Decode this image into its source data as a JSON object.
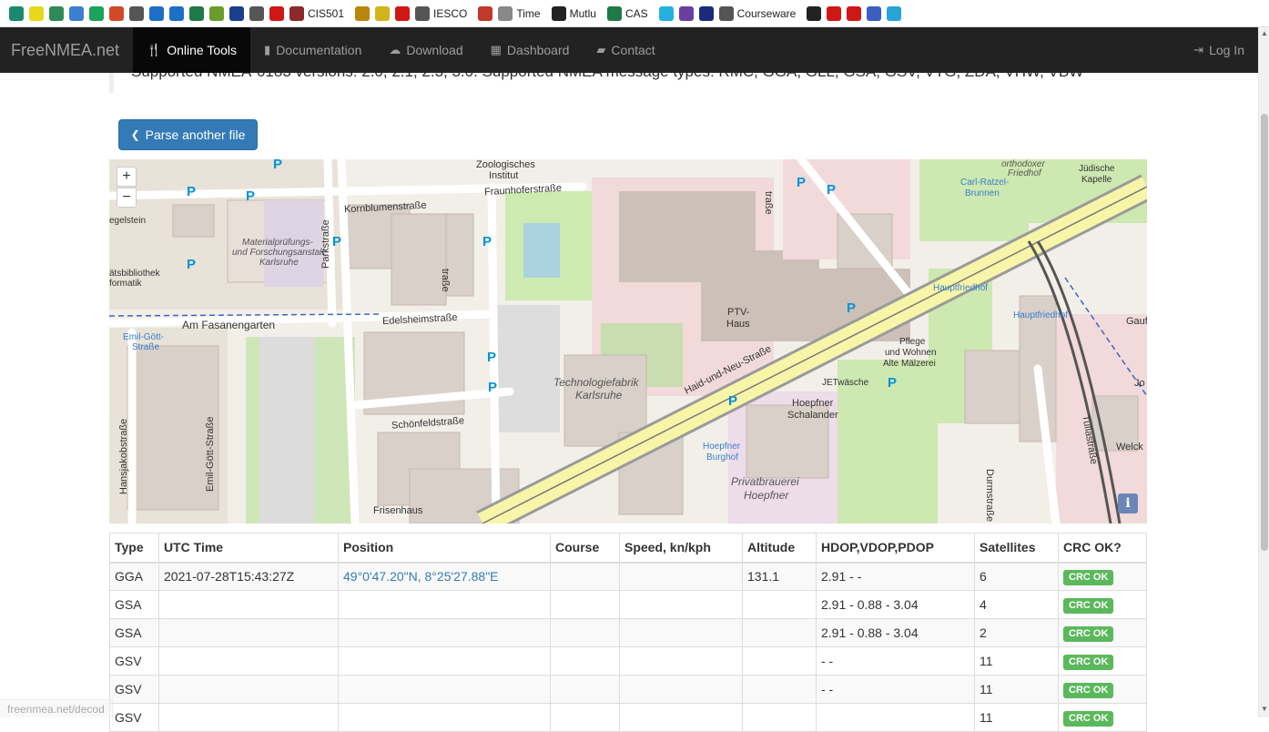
{
  "bookmarks": [
    {
      "icon": "diamond-icon",
      "color": "#1a8a6e",
      "label": ""
    },
    {
      "icon": "c-icon",
      "color": "#e8d81a",
      "label": ""
    },
    {
      "icon": "leaf-icon",
      "color": "#2e8b57",
      "label": ""
    },
    {
      "icon": "photo-icon",
      "color": "#3b7fd1",
      "label": ""
    },
    {
      "icon": "target-icon",
      "color": "#1aa35a",
      "label": ""
    },
    {
      "icon": "paw-icon",
      "color": "#d04a2a",
      "label": ""
    },
    {
      "icon": "mail-icon",
      "color": "#555555",
      "label": ""
    },
    {
      "icon": "sap-icon",
      "color": "#1c6fc4",
      "label": ""
    },
    {
      "icon": "outlook-icon",
      "color": "#1d6fc6",
      "label": ""
    },
    {
      "icon": "stripes-icon",
      "color": "#1f7a4a",
      "label": ""
    },
    {
      "icon": "check-icon",
      "color": "#6a9c2a",
      "label": ""
    },
    {
      "icon": "o2-icon",
      "color": "#1b3f8f",
      "label": ""
    },
    {
      "icon": "doc-icon",
      "color": "#555555",
      "label": ""
    },
    {
      "icon": "u-icon",
      "color": "#d01717",
      "label": ""
    },
    {
      "icon": "crest-icon",
      "color": "#8a2a2a",
      "label": "CIS501"
    },
    {
      "icon": "crest2-icon",
      "color": "#b8860b",
      "label": ""
    },
    {
      "icon": "shield-icon",
      "color": "#d1b41a",
      "label": ""
    },
    {
      "icon": "tick-icon",
      "color": "#d01717",
      "label": ""
    },
    {
      "icon": "doc-icon",
      "color": "#555555",
      "label": "IESCO"
    },
    {
      "icon": "arc-icon",
      "color": "#c0392b",
      "label": ""
    },
    {
      "icon": "dots-icon",
      "color": "#888888",
      "label": "Time"
    },
    {
      "icon": "inf-icon",
      "color": "#222222",
      "label": "Mutlu"
    },
    {
      "icon": "stripes-icon",
      "color": "#1f7a4a",
      "label": "CAS"
    },
    {
      "icon": "w-icon",
      "color": "#26b0e0",
      "label": ""
    },
    {
      "icon": "ws-icon",
      "color": "#6a3fa0",
      "label": ""
    },
    {
      "icon": "wb-icon",
      "color": "#1b2a7a",
      "label": ""
    },
    {
      "icon": "doc-icon",
      "color": "#555555",
      "label": "Courseware"
    },
    {
      "icon": "bookmark-icon",
      "color": "#222222",
      "label": ""
    },
    {
      "icon": "pen-icon",
      "color": "#d01717",
      "label": ""
    },
    {
      "icon": "flower-icon",
      "color": "#d01717",
      "label": ""
    },
    {
      "icon": "cloud-icon",
      "color": "#3b5fbf",
      "label": ""
    },
    {
      "icon": "play-icon",
      "color": "#27a3d8",
      "label": ""
    }
  ],
  "navbar": {
    "brand": "FreeNMEA.net",
    "items": [
      {
        "icon": "cutlery-icon",
        "glyph": "🍴",
        "label": "Online Tools",
        "active": true
      },
      {
        "icon": "book-icon",
        "glyph": "▮",
        "label": "Documentation",
        "active": false
      },
      {
        "icon": "cloud-download-icon",
        "glyph": "☁",
        "label": "Download",
        "active": false
      },
      {
        "icon": "dashboard-icon",
        "glyph": "▦",
        "label": "Dashboard",
        "active": false
      },
      {
        "icon": "comment-icon",
        "glyph": "▰",
        "label": "Contact",
        "active": false
      }
    ],
    "login": {
      "icon": "log-in-icon",
      "glyph": "⇥",
      "label": "Log In"
    }
  },
  "supported_text": "Supported NMEA-0183 versions: 2.0, 2.1, 2.3, 3.0. Supported NMEA message types: RMC, GGA, GLL, GSA, GSV, VTG, ZDA, VHW, VBW",
  "parse_button": {
    "icon": "chevron-left-icon",
    "glyph": "❮",
    "label": "Parse another file"
  },
  "map": {
    "zoom_in": "+",
    "zoom_out": "−",
    "info": "i",
    "labels": {
      "zoologisches": "Zoologisches",
      "institut": "Institut",
      "kornblumen": "Kornblumenstraße",
      "fraunhofer": "Fraunhoferstraße",
      "materialpruef1": "Materialprüfungs-",
      "materialpruef2": "und Forschungsanstalt",
      "materialpruef3": "Karlsruhe",
      "parkstrasse": "Parkstraße",
      "fasanengarten": "Am Fasanengarten",
      "edelsheim": "Edelsheimstraße",
      "emilgott1": "Emil-Gött-",
      "emilgott2": "Straße",
      "emilgottv": "Emil-Gött-Straße",
      "hansjakob": "Hansjakobstraße",
      "schoenfeld": "Schönfeldstraße",
      "frisenhaus": "Frisenhaus",
      "techfabrik1": "Technologiefabrik",
      "techfabrik2": "Karlsruhe",
      "haidneu": "Haid-und-Neu-Straße",
      "ptv1": "PTV-",
      "ptv2": "Haus",
      "hoepfner_schal1": "Hoepfner",
      "hoepfner_schal2": "Schalander",
      "hoepfner_burg1": "Hoepfner",
      "hoepfner_burg2": "Burghof",
      "privatbrauerei1": "Privatbrauerei",
      "privatbrauerei2": "Hoepfner",
      "jetwaesche": "JETwäsche",
      "pflege1": "Pflege",
      "pflege2": "und Wohnen",
      "pflege3": "Alte Mälzerei",
      "hauptfriedhof1": "Hauptfriedhof",
      "hauptfriedhof2": "Hauptfriedhof",
      "carlratzel1": "Carl-Ratzel-",
      "carlratzel2": "Brunnen",
      "orthodox1": "orthodoxer",
      "orthodox2": "Friedhof",
      "juedische1": "Jüdische",
      "juedische2": "Kapelle",
      "durmstrasse": "Durmstraße",
      "tullastrasse": "Tullastraße",
      "hirschbiegel": "egelstein",
      "bibliothek1": "ätsbibliothek",
      "bibliothek2": "formatik",
      "gauf": "Gauf",
      "welck": "Welck",
      "jo": "Jo",
      "strasse_hz": "traße"
    }
  },
  "table": {
    "headers": [
      "Type",
      "UTC Time",
      "Position",
      "Course",
      "Speed, kn/kph",
      "Altitude",
      "HDOP,VDOP,PDOP",
      "Satellites",
      "CRC OK?"
    ],
    "rows": [
      {
        "type": "GGA",
        "utc": "2021-07-28T15:43:27Z",
        "position": "49°0'47.20\"N, 8°25'27.88\"E",
        "course": "",
        "speed": "",
        "altitude": "131.1",
        "dop": "2.91 - -",
        "satellites": "6",
        "crc": "CRC OK"
      },
      {
        "type": "GSA",
        "utc": "",
        "position": "",
        "course": "",
        "speed": "",
        "altitude": "",
        "dop": "2.91 - 0.88 - 3.04",
        "satellites": "4",
        "crc": "CRC OK"
      },
      {
        "type": "GSA",
        "utc": "",
        "position": "",
        "course": "",
        "speed": "",
        "altitude": "",
        "dop": "2.91 - 0.88 - 3.04",
        "satellites": "2",
        "crc": "CRC OK"
      },
      {
        "type": "GSV",
        "utc": "",
        "position": "",
        "course": "",
        "speed": "",
        "altitude": "",
        "dop": "- -",
        "satellites": "11",
        "crc": "CRC OK"
      },
      {
        "type": "GSV",
        "utc": "",
        "position": "",
        "course": "",
        "speed": "",
        "altitude": "",
        "dop": "- -",
        "satellites": "11",
        "crc": "CRC OK"
      },
      {
        "type": "GSV",
        "utc": "",
        "position": "",
        "course": "",
        "speed": "",
        "altitude": "",
        "dop": "",
        "satellites": "11",
        "crc": "CRC OK"
      }
    ]
  },
  "status_url": "freenmea.net/decod"
}
